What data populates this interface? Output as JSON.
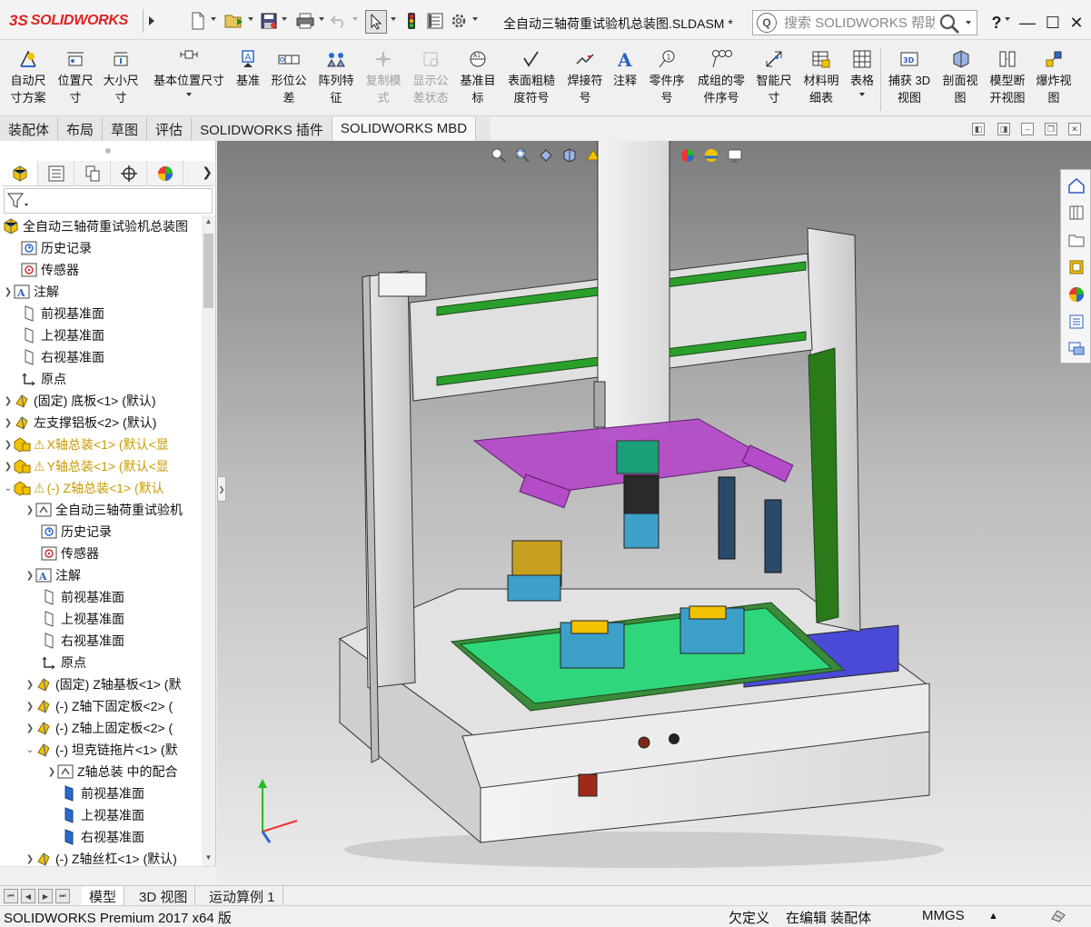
{
  "app": {
    "brand_ds": "3S",
    "brand_name": "SOLIDWORKS"
  },
  "document": {
    "title": "全自动三轴荷重试验机总装图.SLDASM *"
  },
  "search": {
    "placeholder": "搜索 SOLIDWORKS 帮助",
    "help_badge": "Q"
  },
  "window": {
    "help": "?",
    "minimize": "—",
    "maximize": "☐",
    "close": "✕"
  },
  "ribbon": {
    "auto_dim_scheme": "自动尺\n寸方案",
    "location_dim": "位置尺\n寸",
    "size_dim": "大小尺\n寸",
    "basic_location_dim": "基本位置尺寸",
    "datum": "基准",
    "geometric_tolerance": "形位公\n差",
    "pattern_feature": "阵列特\n征",
    "copy_scheme": "复制模\n式",
    "show_tolerance_status": "显示公\n差状态",
    "datum_target": "基准目\n标",
    "surface_finish": "表面粗糙\n度符号",
    "weld_symbol": "焊接符\n号",
    "note": "注释",
    "part_number": "零件序\n号",
    "auto_balloon": "成组的零\n件序号",
    "smart_dim": "智能尺\n寸",
    "bom": "材料明\n细表",
    "table": "表格",
    "capture_3d_view": "捕获 3D\n视图",
    "section_view": "剖面视\n图",
    "model_break_view": "模型断\n开视图",
    "explode_view": "爆炸视\n图"
  },
  "tabs": [
    {
      "label": "装配体"
    },
    {
      "label": "布局"
    },
    {
      "label": "草图"
    },
    {
      "label": "评估"
    },
    {
      "label": "SOLIDWORKS 插件"
    },
    {
      "label": "SOLIDWORKS MBD"
    }
  ],
  "tree": {
    "root": "全自动三轴荷重试验机总装图",
    "items": [
      {
        "label": "历史记录"
      },
      {
        "label": "传感器"
      },
      {
        "label": "注解"
      },
      {
        "label": "前视基准面"
      },
      {
        "label": "上视基准面"
      },
      {
        "label": "右视基准面"
      },
      {
        "label": "原点"
      },
      {
        "label": "(固定) 底板<1> (默认)"
      },
      {
        "label": "左支撑铝板<2> (默认)"
      },
      {
        "label": "X轴总装<1> (默认<显"
      },
      {
        "label": "Y轴总装<1> (默认<显"
      },
      {
        "label": "(-) Z轴总装<1> (默认"
      },
      {
        "label": "全自动三轴荷重试验机"
      },
      {
        "label": "历史记录"
      },
      {
        "label": "传感器"
      },
      {
        "label": "注解"
      },
      {
        "label": "前视基准面"
      },
      {
        "label": "上视基准面"
      },
      {
        "label": "右视基准面"
      },
      {
        "label": "原点"
      },
      {
        "label": "(固定) Z轴基板<1> (默"
      },
      {
        "label": "(-) Z轴下固定板<2> ("
      },
      {
        "label": "(-) Z轴上固定板<2> ("
      },
      {
        "label": "(-) 坦克链拖片<1> (默"
      },
      {
        "label": "Z轴总装 中的配合"
      },
      {
        "label": "前视基准面"
      },
      {
        "label": "上视基准面"
      },
      {
        "label": "右视基准面"
      },
      {
        "label": "(-) Z轴丝杠<1> (默认)"
      }
    ]
  },
  "bottom_tabs": [
    {
      "label": "模型"
    },
    {
      "label": "3D 视图"
    },
    {
      "label": "运动算例 1"
    }
  ],
  "status": {
    "version": "SOLIDWORKS Premium 2017 x64 版",
    "define_state": "欠定义",
    "edit_state": "在编辑 装配体",
    "units": "MMGS"
  },
  "colors": {
    "brand_red": "#d22222",
    "warning_yellow": "#d4a000",
    "viewport_top": "#7d7d7d",
    "viewport_bottom": "#ececec"
  }
}
